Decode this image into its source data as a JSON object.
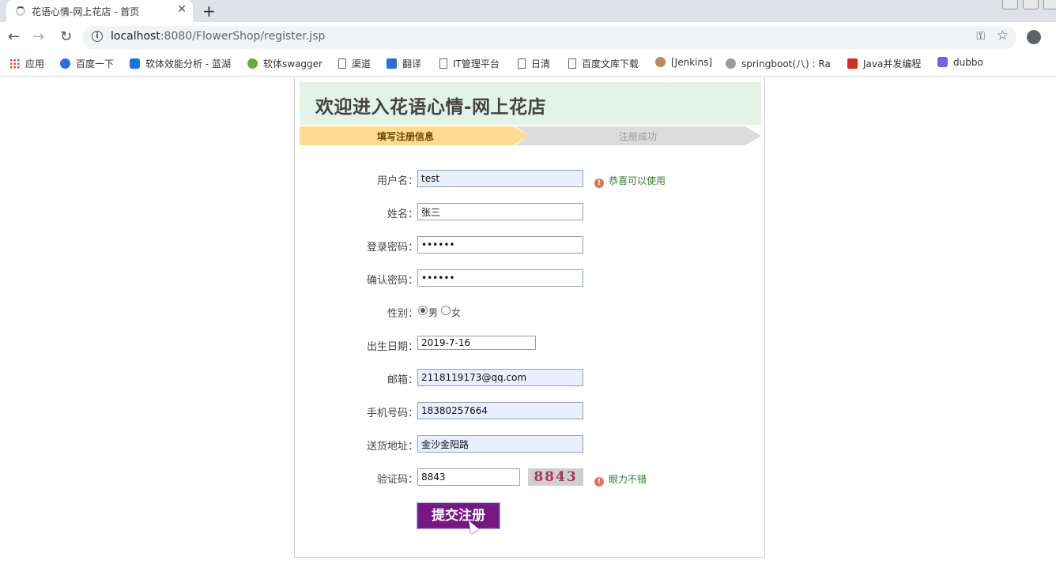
{
  "browser": {
    "tab_title": "花语心情-网上花店 - 首页",
    "tab_close": "✕",
    "new_tab": "+",
    "url_host": "localhost",
    "url_rest": ":8080/FlowerShop/register.jsp",
    "back": "←",
    "forward": "→",
    "reload": "↻",
    "key_icon": "⚿",
    "star_icon": "☆"
  },
  "bookmarks": [
    {
      "label": "应用",
      "icon": "apps-grid-icon"
    },
    {
      "label": "百度一下",
      "icon": "baidu-icon"
    },
    {
      "label": "软体效能分析 - 蓝湖",
      "icon": "lanhu-icon"
    },
    {
      "label": "软体swagger",
      "icon": "swagger-icon"
    },
    {
      "label": "渠道",
      "icon": "page-icon"
    },
    {
      "label": "翻译",
      "icon": "translate-icon"
    },
    {
      "label": "IT管理平台",
      "icon": "page-icon"
    },
    {
      "label": "日清",
      "icon": "page-icon"
    },
    {
      "label": "百度文库下载",
      "icon": "page-icon"
    },
    {
      "label": "[Jenkins]",
      "icon": "jenkins-icon"
    },
    {
      "label": "springboot(八) : Ra",
      "icon": "globe-icon"
    },
    {
      "label": "Java并发编程",
      "icon": "csdn-icon"
    },
    {
      "label": "dubbo",
      "icon": "dubbo-icon"
    }
  ],
  "page": {
    "title": "欢迎进入花语心情-网上花店",
    "step1": "填写注册信息",
    "step2": "注册成功"
  },
  "form": {
    "username_label": "用户名：",
    "username_value": "test",
    "username_hint": "恭喜可以使用",
    "name_label": "姓名：",
    "name_value": "张三",
    "password_label": "登录密码：",
    "password_value": "••••••",
    "confirm_label": "确认密码：",
    "confirm_value": "••••••",
    "gender_label": "性别：",
    "gender_male": "男",
    "gender_female": "女",
    "birth_label": "出生日期：",
    "birth_value": "2019-7-16",
    "email_label": "邮箱：",
    "email_value": "2118119173@qq.com",
    "phone_label": "手机号码：",
    "phone_value": "18380257664",
    "address_label": "送货地址：",
    "address_value": "金沙金阳路",
    "captcha_label": "验证码：",
    "captcha_value": "8843",
    "captcha_image_text": "8843",
    "captcha_hint": "眼力不错",
    "submit_label": "提交注册",
    "warn_icon_glyph": "!"
  }
}
